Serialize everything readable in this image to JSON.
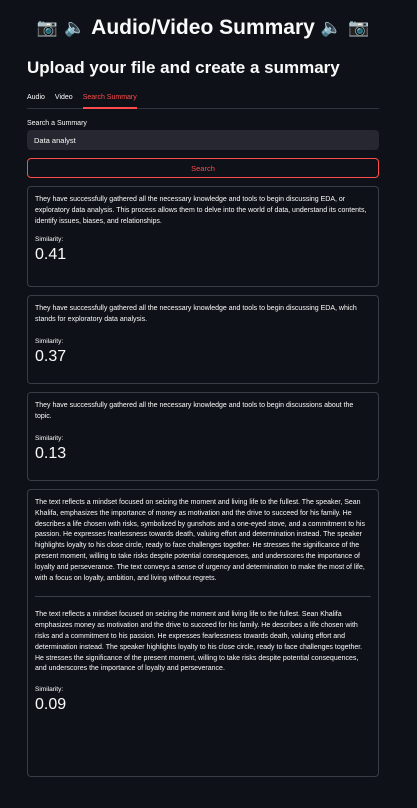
{
  "header": {
    "title": "Audio/Video Summary",
    "subtitle": "Upload your file and create a summary"
  },
  "tabs": [
    {
      "label": "Audio"
    },
    {
      "label": "Video"
    },
    {
      "label": "Search Summary"
    }
  ],
  "search": {
    "label": "Search a Summary",
    "value": "Data analyst",
    "button_label": "Search"
  },
  "results": [
    {
      "text": "They have successfully gathered all the necessary knowledge and tools to begin discussing EDA, or exploratory data analysis. This process allows them to delve into the world of data, understand its contents, identify issues, biases, and relationships.",
      "similarity_label": "Similarity:",
      "similarity": "0.41"
    },
    {
      "text": "They have successfully gathered all the necessary knowledge and tools to begin discussing EDA, which stands for exploratory data analysis.",
      "similarity_label": "Similarity:",
      "similarity": "0.37"
    },
    {
      "text": "They have successfully gathered all the necessary knowledge and tools to begin discussions about the topic.",
      "similarity_label": "Similarity:",
      "similarity": "0.13"
    },
    {
      "text": "The text reflects a mindset focused on seizing the moment and living life to the fullest. The speaker, Sean Khalifa, emphasizes the importance of money as motivation and the drive to succeed for his family. He describes a life chosen with risks, symbolized by gunshots and a one-eyed stove, and a commitment to his passion. He expresses fearlessness towards death, valuing effort and determination instead. The speaker highlights loyalty to his close circle, ready to face challenges together. He stresses the significance of the present moment, willing to take risks despite potential consequences, and underscores the importance of loyalty and perseverance. The text conveys a sense of urgency and determination to make the most of life, with a focus on loyalty, ambition, and living without regrets.",
      "text2": "The text reflects a mindset focused on seizing the moment and living life to the fullest. Sean Khalifa emphasizes money as motivation and the drive to succeed for his family. He describes a life chosen with risks and a commitment to his passion. He expresses fearlessness towards death, valuing effort and determination instead. The speaker highlights loyalty to his close circle, ready to face challenges together. He stresses the significance of the present moment, willing to take risks despite potential consequences, and underscores the importance of loyalty and perseverance.",
      "similarity_label": "Similarity:",
      "similarity": "0.09"
    }
  ],
  "icons": [
    "camera-icon",
    "speaker-icon"
  ]
}
